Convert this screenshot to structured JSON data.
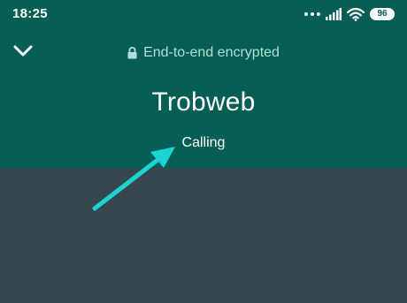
{
  "status_bar": {
    "time": "18:25",
    "battery_level": "96",
    "icons": [
      "more-dots-icon",
      "signal-icon",
      "wifi-icon",
      "battery-icon"
    ]
  },
  "header": {
    "collapse_icon": "chevron-down-icon",
    "encryption_icon": "lock-icon",
    "encryption_text": "End-to-end encrypted",
    "contact_name": "Trobweb",
    "call_status": "Calling"
  },
  "annotation": {
    "icon": "arrow-icon",
    "color": "#1ed3d3"
  },
  "colors": {
    "header_bg": "#075e54",
    "body_bg": "#37474f",
    "muted_text": "#b2dfdb"
  }
}
